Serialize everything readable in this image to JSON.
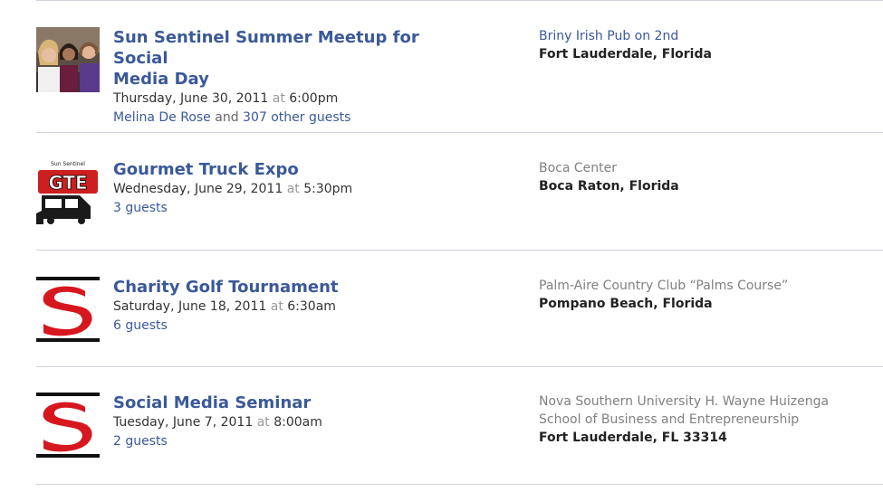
{
  "events": [
    {
      "title_line1": "Sun Sentinel Summer Meetup for Social",
      "title_line2": "Media Day",
      "date": "Thursday, June 30, 2011",
      "at": "at",
      "time": "6:00pm",
      "host": "Melina De Rose",
      "and": "and",
      "guests": "307 other guests",
      "venue_line1": "Briny Irish Pub on 2nd",
      "city": "Fort Lauderdale, Florida",
      "thumb": "group-photo"
    },
    {
      "title_line1": "Gourmet Truck Expo",
      "date": "Wednesday, June 29, 2011",
      "at": "at",
      "time": "5:30pm",
      "guests": "3 guests",
      "venue_line1": "Boca Center",
      "city": "Boca Raton, Florida",
      "thumb": "gte-truck-logo",
      "thumb_text": "GTE",
      "thumb_caption": "Sun Sentinel"
    },
    {
      "title_line1": "Charity Golf Tournament",
      "date": "Saturday, June 18, 2011",
      "at": "at",
      "time": "6:30am",
      "guests": "6 guests",
      "venue_line1": "Palm-Aire Country Club “Palms Course”",
      "city": "Pompano Beach, Florida",
      "thumb": "sun-sentinel-s-logo"
    },
    {
      "title_line1": "Social Media Seminar",
      "date": "Tuesday, June 7, 2011",
      "at": "at",
      "time": "8:00am",
      "guests": "2 guests",
      "venue_line1": "Nova Southern University H. Wayne Huizenga",
      "venue_line2": "School of Business and Entrepreneurship",
      "city": "Fort Lauderdale, FL 33314",
      "thumb": "sun-sentinel-s-logo"
    }
  ],
  "colors": {
    "link": "#3b5998",
    "divider": "#cfd4dc",
    "logo_red": "#d7171f"
  }
}
